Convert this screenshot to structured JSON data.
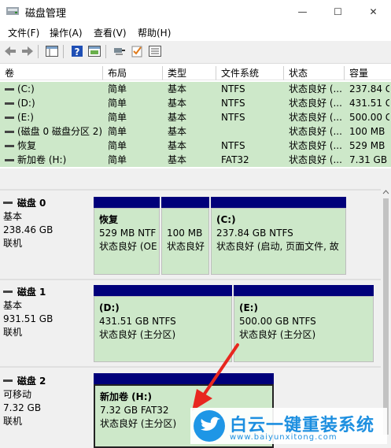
{
  "window": {
    "title": "磁盘管理",
    "minimize": "—",
    "maximize": "☐",
    "close": "✕"
  },
  "menu": [
    "文件(F)",
    "操作(A)",
    "查看(V)",
    "帮助(H)"
  ],
  "list": {
    "headers": [
      "卷",
      "布局",
      "类型",
      "文件系统",
      "状态",
      "容量"
    ],
    "rows": [
      [
        "(C:)",
        "简单",
        "基本",
        "NTFS",
        "状态良好 (...",
        "237.84 G"
      ],
      [
        "(D:)",
        "简单",
        "基本",
        "NTFS",
        "状态良好 (...",
        "431.51 G"
      ],
      [
        "(E:)",
        "简单",
        "基本",
        "NTFS",
        "状态良好 (...",
        "500.00 G"
      ],
      [
        "(磁盘 0 磁盘分区 2)",
        "简单",
        "基本",
        "",
        "状态良好 (...",
        "100 MB"
      ],
      [
        "恢复",
        "简单",
        "基本",
        "NTFS",
        "状态良好 (...",
        "529 MB"
      ],
      [
        "新加卷 (H:)",
        "简单",
        "基本",
        "FAT32",
        "状态良好 (...",
        "7.31 GB"
      ]
    ]
  },
  "disks": [
    {
      "name": "磁盘 0",
      "type": "基本",
      "size": "238.46 GB",
      "status": "联机",
      "partitions": [
        {
          "label": "恢复",
          "size": "529 MB NTF",
          "status": "状态良好 (OE"
        },
        {
          "label": "",
          "size": "100 MB",
          "status": "状态良好"
        },
        {
          "label": "(C:)",
          "size": "237.84 GB NTFS",
          "status": "状态良好 (启动, 页面文件, 故"
        }
      ]
    },
    {
      "name": "磁盘 1",
      "type": "基本",
      "size": "931.51 GB",
      "status": "联机",
      "partitions": [
        {
          "label": "(D:)",
          "size": "431.51 GB NTFS",
          "status": "状态良好 (主分区)"
        },
        {
          "label": "(E:)",
          "size": "500.00 GB NTFS",
          "status": "状态良好 (主分区)"
        }
      ]
    },
    {
      "name": "磁盘 2",
      "type": "可移动",
      "size": "7.32 GB",
      "status": "联机",
      "partitions": [
        {
          "label": "新加卷  (H:)",
          "size": "7.32 GB FAT32",
          "status": "状态良好 (主分区)"
        }
      ]
    }
  ],
  "watermark": {
    "title": "白云一键重装系统",
    "url": "www.baiyunxitong.com"
  },
  "colors": {
    "partition_bar": "#00007a",
    "partition_fill": "#cde8c9",
    "arrow": "#e8261f"
  }
}
